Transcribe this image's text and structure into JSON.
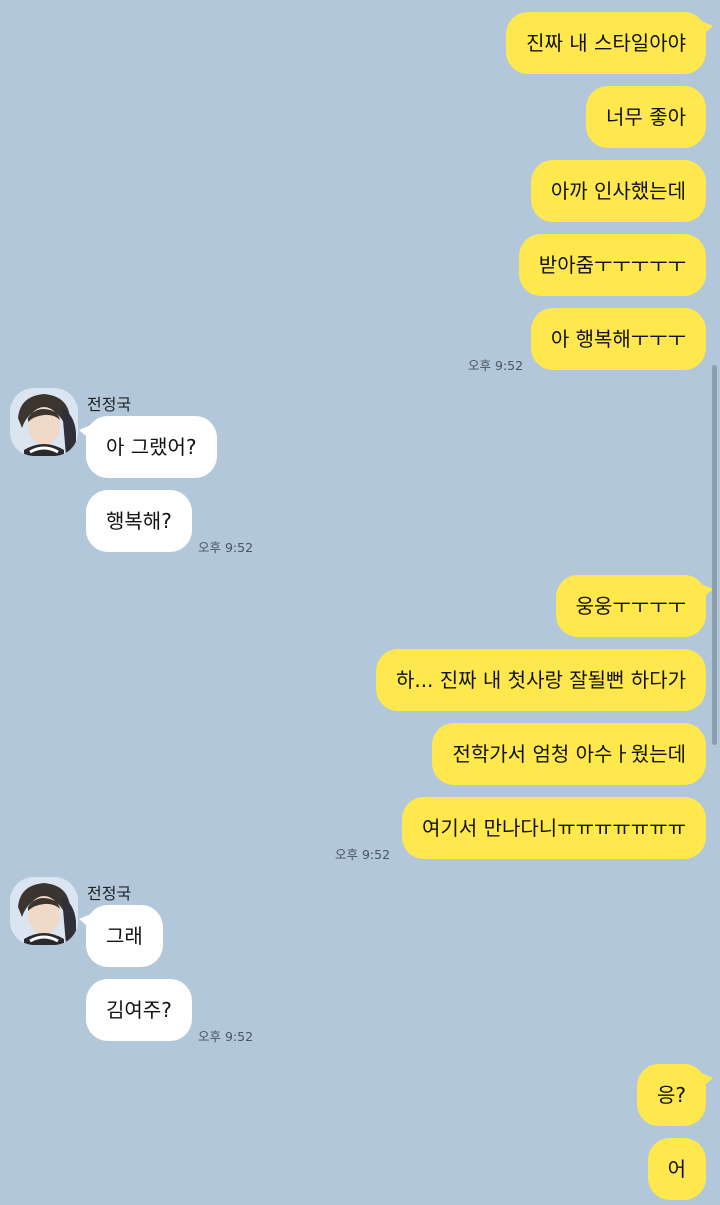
{
  "colors": {
    "background": "#b2c7da",
    "my_bubble": "#fee84d",
    "their_bubble": "#ffffff"
  },
  "sender_name": "전정국",
  "messages": {
    "m1": "진짜 내 스타일아야",
    "m2": "너무 좋아",
    "m3": "아까 인사했는데",
    "m4": "받아줌ㅜㅜㅜㅜㅜ",
    "m5": "아 행복해ㅜㅜㅜ",
    "t1": "오후 9:52",
    "r1": "아 그랬어?",
    "r2": "행복해?",
    "t2": "오후 9:52",
    "m6": "웅웅ㅜㅜㅜㅜ",
    "m7": "하... 진짜 내 첫사랑 잘될뻔 하다가",
    "m8": "전학가서 엄청 아수ㅏ웠는데",
    "m9": "여기서 만나다니ㅠㅠㅠㅠㅠㅠㅠ",
    "t3": "오후 9:52",
    "r3": "그래",
    "r4": "김여주?",
    "t4": "오후 9:52",
    "m10": "응?",
    "m11": "어"
  },
  "icons": {
    "avatar": "profile-avatar-icon"
  }
}
